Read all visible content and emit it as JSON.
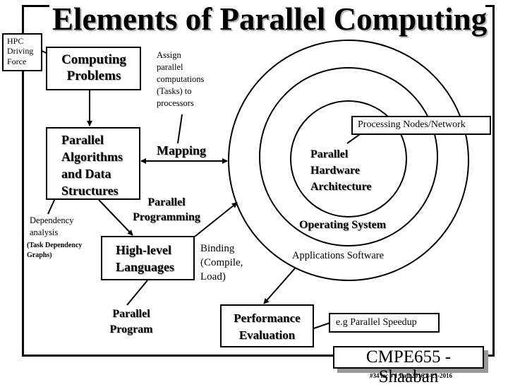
{
  "slide": {
    "title": "Elements of Parallel Computing",
    "hpc_label": [
      "HPC",
      "Driving",
      "Force"
    ],
    "computing_problems": [
      "Computing",
      "Problems"
    ],
    "assign_note": [
      "Assign",
      "parallel",
      "computations",
      "(Tasks) to",
      "processors"
    ],
    "parallel_algorithms": [
      "Parallel",
      "Algorithms",
      "and Data",
      "Structures"
    ],
    "mapping_label": "Mapping",
    "dependency_note": [
      "Dependency",
      "analysis"
    ],
    "task_graphs_note": [
      "(Task Dependency",
      "Graphs)"
    ],
    "parallel_programming": [
      "Parallel",
      "Programming"
    ],
    "high_level_languages": [
      "High-level",
      "Languages"
    ],
    "binding_note": [
      "Binding",
      "(Compile,",
      "Load)"
    ],
    "parallel_program": [
      "Parallel",
      "Program"
    ],
    "processing_nodes": "Processing Nodes/Network",
    "parallel_hardware": [
      "Parallel",
      "Hardware",
      "Architecture"
    ],
    "operating_system": "Operating System",
    "applications_software": "Applications Software",
    "performance_evaluation": [
      "Performance",
      "Evaluation"
    ],
    "speedup_note": "e.g Parallel Speedup",
    "course_badge": "CMPE655 - Shaaban",
    "footnote": "#34  lec # 1   Fall 2016   8-23-2016"
  }
}
